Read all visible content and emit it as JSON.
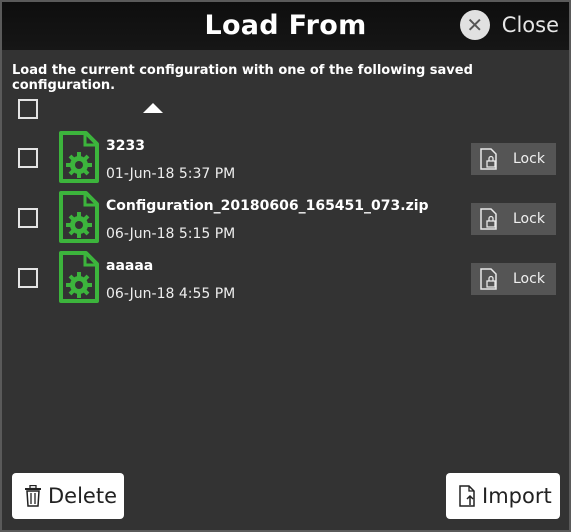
{
  "dialog": {
    "title": "Load From",
    "close_label": "Close",
    "subtitle": "Load the current configuration with one of the following saved configuration."
  },
  "files": [
    {
      "name": "3233",
      "date": "01-Jun-18 5:37 PM",
      "lock_label": "Lock"
    },
    {
      "name": "Configuration_20180606_165451_073.zip",
      "date": "06-Jun-18 5:15 PM",
      "lock_label": "Lock"
    },
    {
      "name": "aaaaa",
      "date": "06-Jun-18 4:55 PM",
      "lock_label": "Lock"
    }
  ],
  "footer": {
    "delete_label": "Delete",
    "import_label": "Import"
  },
  "colors": {
    "background": "#333333",
    "titlebar": "#111111",
    "file_icon_green": "#3cb43c",
    "lock_button": "#555555"
  },
  "icons": [
    "close-icon",
    "file-gear-icon",
    "lock-file-icon",
    "trash-icon",
    "import-file-icon",
    "sort-ascending-icon"
  ]
}
